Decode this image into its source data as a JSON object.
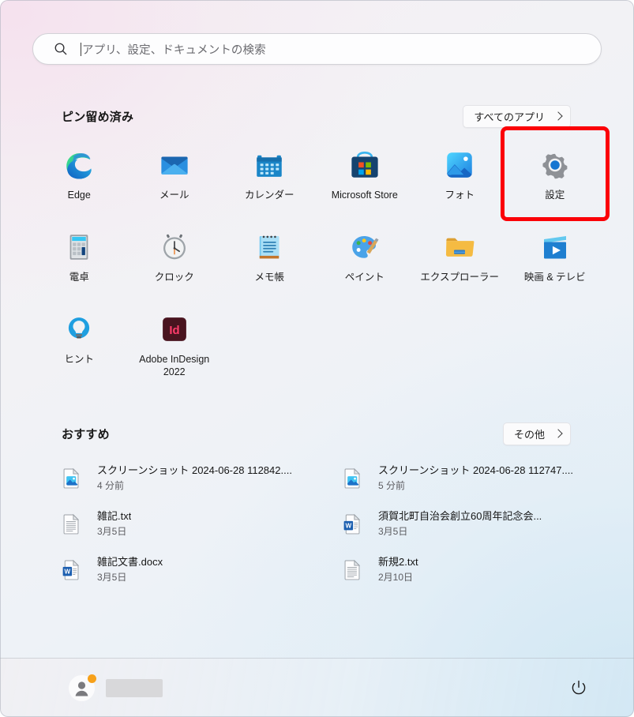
{
  "window": {
    "title": "Windows 11 Start Menu"
  },
  "search": {
    "placeholder": "アプリ、設定、ドキュメントの検索",
    "value": "",
    "icon": "search-icon"
  },
  "pinned": {
    "title": "ピン留め済み",
    "all_apps_label": "すべてのアプリ",
    "all_apps_icon": "chevron-right-icon",
    "apps": [
      {
        "label": "Edge",
        "icon": "edge-icon",
        "highlighted": false
      },
      {
        "label": "メール",
        "icon": "mail-icon",
        "highlighted": false
      },
      {
        "label": "カレンダー",
        "icon": "calendar-icon",
        "highlighted": false
      },
      {
        "label": "Microsoft Store",
        "icon": "microsoft-store-icon",
        "highlighted": false
      },
      {
        "label": "フォト",
        "icon": "photos-icon",
        "highlighted": false
      },
      {
        "label": "設定",
        "icon": "settings-gear-icon",
        "highlighted": true
      },
      {
        "label": "電卓",
        "icon": "calculator-icon",
        "highlighted": false
      },
      {
        "label": "クロック",
        "icon": "clock-icon",
        "highlighted": false
      },
      {
        "label": "メモ帳",
        "icon": "notepad-icon",
        "highlighted": false
      },
      {
        "label": "ペイント",
        "icon": "paint-palette-icon",
        "highlighted": false
      },
      {
        "label": "エクスプローラー",
        "icon": "file-explorer-icon",
        "highlighted": false
      },
      {
        "label": "映画 & テレビ",
        "icon": "movies-tv-icon",
        "highlighted": false
      },
      {
        "label": "ヒント",
        "icon": "tips-lightbulb-icon",
        "highlighted": false
      },
      {
        "label": "Adobe InDesign\n2022",
        "icon": "adobe-indesign-icon",
        "highlighted": false
      }
    ]
  },
  "recommended": {
    "title": "おすすめ",
    "more_label": "その他",
    "more_icon": "chevron-right-icon",
    "items": [
      {
        "name": "スクリーンショット 2024-06-28 112842....",
        "subtitle": "4 分前",
        "icon": "image-file-icon"
      },
      {
        "name": "スクリーンショット 2024-06-28 112747....",
        "subtitle": "5 分前",
        "icon": "image-file-icon"
      },
      {
        "name": "雑記.txt",
        "subtitle": "3月5日",
        "icon": "text-file-icon"
      },
      {
        "name": "須賀北町自治会創立60周年記念会...",
        "subtitle": "3月5日",
        "icon": "word-file-icon"
      },
      {
        "name": "雑記文書.docx",
        "subtitle": "3月5日",
        "icon": "word-file-icon"
      },
      {
        "name": "新規2.txt",
        "subtitle": "2月10日",
        "icon": "text-file-icon"
      }
    ]
  },
  "footer": {
    "account": {
      "name": "",
      "icon": "user-avatar-icon",
      "badge_color": "#f7a11a",
      "name_redacted": true
    },
    "power": {
      "label": "",
      "icon": "power-icon"
    }
  },
  "annotation": {
    "highlight_color": "#fb0007",
    "target": "設定"
  }
}
